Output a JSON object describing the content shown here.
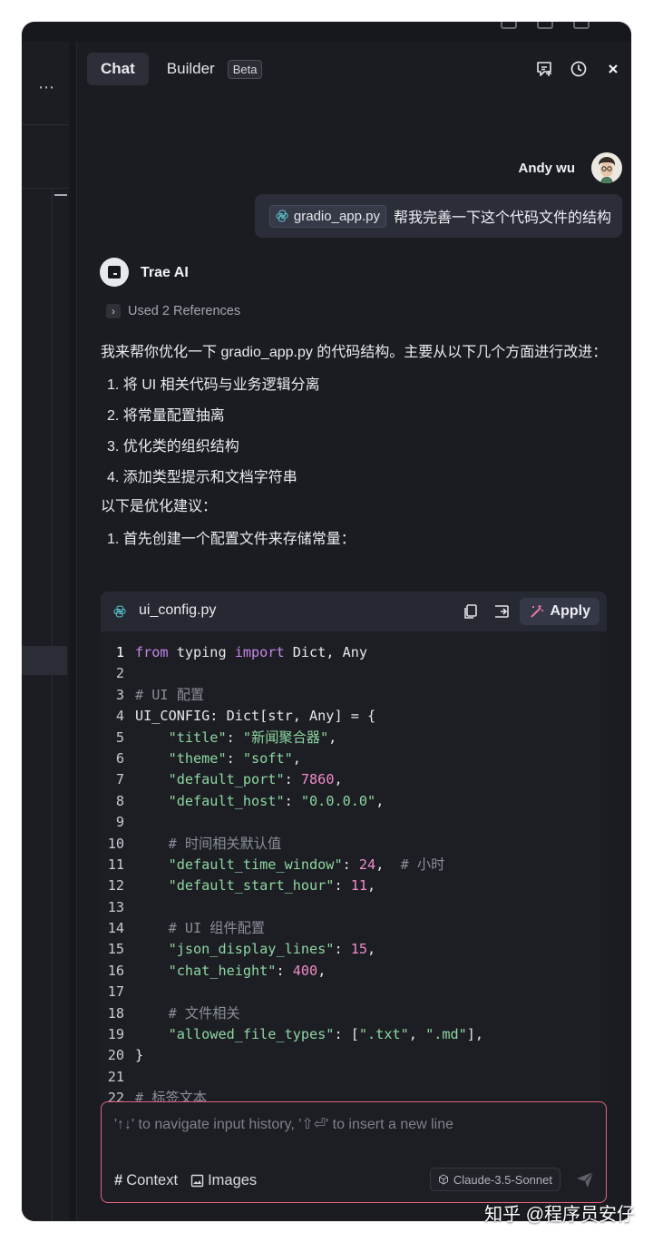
{
  "header": {
    "tab_chat": "Chat",
    "tab_builder": "Builder",
    "beta_badge": "Beta",
    "left_more": "⋯"
  },
  "user_message": {
    "name": "Andy wu",
    "file_chip": "gradio_app.py",
    "text": "帮我完善一下这个代码文件的结构"
  },
  "assistant": {
    "name": "Trae AI",
    "references": "Used 2 References",
    "intro": "我来帮你优化一下 gradio_app.py 的代码结构。主要从以下几个方面进行改进：",
    "points": [
      "1. 将 UI 相关代码与业务逻辑分离",
      "2. 将常量配置抽离",
      "3. 优化类的组织结构",
      "4. 添加类型提示和文档字符串"
    ],
    "suggestion_title": "以下是优化建议：",
    "step1": "1. 首先创建一个配置文件来存储常量："
  },
  "code_block": {
    "filename": "ui_config.py",
    "apply_label": "Apply",
    "line_numbers": [
      "1",
      "2",
      "3",
      "4",
      "5",
      "6",
      "7",
      "8",
      "9",
      "10",
      "11",
      "12",
      "13",
      "14",
      "15",
      "16",
      "17",
      "18",
      "19",
      "20",
      "21",
      "22"
    ]
  },
  "input": {
    "placeholder": "'↑↓' to navigate input history, '⇧⏎' to insert a new line",
    "context_label": "Context",
    "images_label": "Images",
    "model": "Claude-3.5-Sonnet"
  },
  "watermark": "知乎 @程序员安仔",
  "colors": {
    "accent_border": "#e2647a",
    "keyword": "#c586e8",
    "string": "#8ed6a0",
    "number": "#f08cc8"
  }
}
